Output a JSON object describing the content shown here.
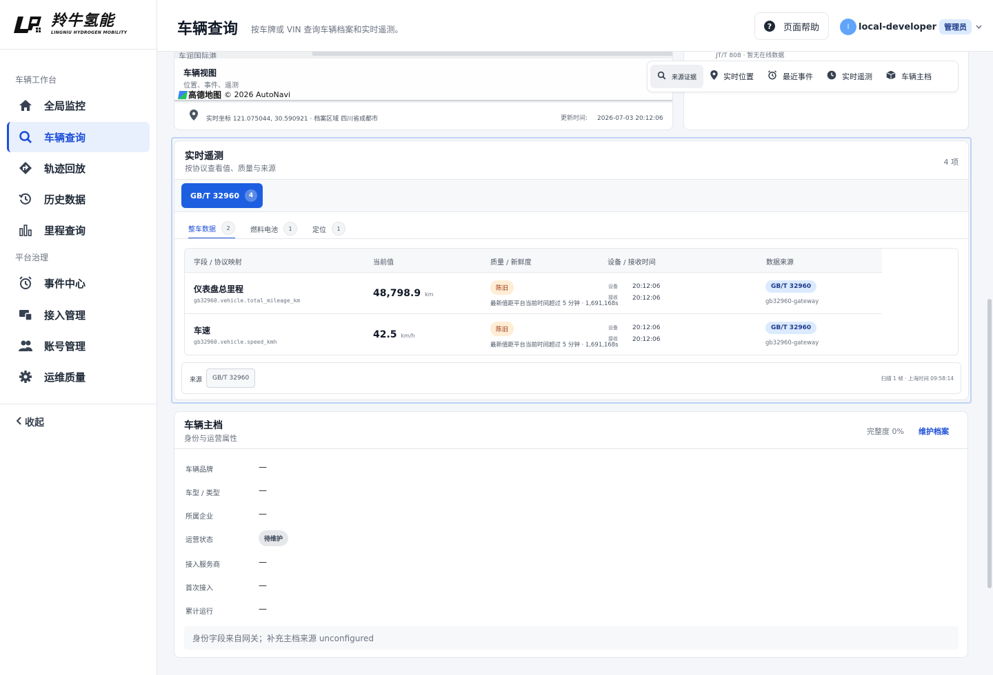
{
  "brand": {
    "name_cn": "羚牛氢能",
    "name_en": "LINGNIU HYDROGEN MOBILITY"
  },
  "sidebar": {
    "group1": "车辆工作台",
    "group2": "平台治理",
    "items": [
      {
        "label": "全局监控",
        "icon": "home-icon"
      },
      {
        "label": "车辆查询",
        "icon": "search-icon",
        "active": true
      },
      {
        "label": "轨迹回放",
        "icon": "route-icon"
      },
      {
        "label": "历史数据",
        "icon": "history-icon"
      },
      {
        "label": "里程查询",
        "icon": "bar-chart-icon"
      },
      {
        "label": "事件中心",
        "icon": "alarm-clock-icon"
      },
      {
        "label": "接入管理",
        "icon": "devices-icon"
      },
      {
        "label": "账号管理",
        "icon": "users-icon"
      },
      {
        "label": "运维质量",
        "icon": "gear-icon"
      }
    ],
    "collapse_label": "收起"
  },
  "header": {
    "title": "车辆查询",
    "subtitle": "按车牌或 VIN 查询车辆档案和实时遥测。",
    "help_label": "页面帮助",
    "avatar_initial": "l",
    "username": "local-developer",
    "role": "管理员"
  },
  "map": {
    "top_label": "车润国际港",
    "view_title": "车辆视图",
    "view_sub": "位置、事件、遥测",
    "amap_brand": "高德地图",
    "copyright": "© 2026 AutoNavi",
    "coord_text": "实时坐标 121.075044, 30.590921 · 档案区域 四川省成都市",
    "updated_label": "更新时间:",
    "updated_value": "2026-07-03 20:12:06"
  },
  "side_card": {
    "text": "JT/T 808 · 暂无在线数据"
  },
  "toolbar": {
    "items": [
      {
        "label": "来源证据",
        "icon": "search-icon"
      },
      {
        "label": "实时位置",
        "icon": "pin-icon"
      },
      {
        "label": "最近事件",
        "icon": "alarm-clock-icon"
      },
      {
        "label": "实时遥测",
        "icon": "clock-icon"
      },
      {
        "label": "车辆主档",
        "icon": "box-icon"
      }
    ]
  },
  "telemetry": {
    "title": "实时遥测",
    "subtitle": "按协议查看值、质量与来源",
    "count": "4 项",
    "protocol": {
      "label": "GB/T 32960",
      "count": "4"
    },
    "tabs": [
      {
        "label": "整车数据",
        "count": "2"
      },
      {
        "label": "燃料电池",
        "count": "1"
      },
      {
        "label": "定位",
        "count": "1"
      }
    ],
    "columns": [
      "字段 / 协议映射",
      "当前值",
      "质量 / 新鲜度",
      "设备 / 接收时间",
      "数据来源"
    ],
    "rows": [
      {
        "name": "仪表盘总里程",
        "key": "gb32960.vehicle.total_mileage_km",
        "value": "48,798.9",
        "unit": "km",
        "quality": "陈旧",
        "quality_desc": "最新值距平台当前时间超过 5 分钟 · 1,691,168s",
        "device_label": "设备",
        "device_time": "20:12:06",
        "recv_label": "接收",
        "recv_time": "20:12:06",
        "source": "GB/T 32960",
        "source_sub": "gb32960-gateway"
      },
      {
        "name": "车速",
        "key": "gb32960.vehicle.speed_kmh",
        "value": "42.5",
        "unit": "km/h",
        "quality": "陈旧",
        "quality_desc": "最新值距平台当前时间超过 5 分钟 · 1,691,168s",
        "device_label": "设备",
        "device_time": "20:12:06",
        "recv_label": "接收",
        "recv_time": "20:12:06",
        "source": "GB/T 32960",
        "source_sub": "gb32960-gateway"
      }
    ],
    "source_label": "来源",
    "source_chip": "GB/T 32960",
    "scan_text": "扫描 1 帧 · 上海时间 09:58:14"
  },
  "master": {
    "title": "车辆主档",
    "subtitle": "身份与运营属性",
    "completeness": "完整度 0%",
    "maintain_label": "维护档案",
    "attrs": [
      {
        "label": "车辆品牌",
        "value": "—"
      },
      {
        "label": "车型 / 类型",
        "value": "—"
      },
      {
        "label": "所属企业",
        "value": "—"
      },
      {
        "label": "运营状态",
        "value": "待维护"
      },
      {
        "label": "接入服务商",
        "value": "—"
      },
      {
        "label": "首次接入",
        "value": "—"
      },
      {
        "label": "累计运行",
        "value": "—"
      }
    ],
    "note": "身份字段来自网关；补充主档来源 unconfigured"
  },
  "colors": {
    "accent": "#1d4ed8",
    "primary_button": "#1d5fe0",
    "stale": "#ffedd5",
    "source_badge": "#dbeafe"
  }
}
